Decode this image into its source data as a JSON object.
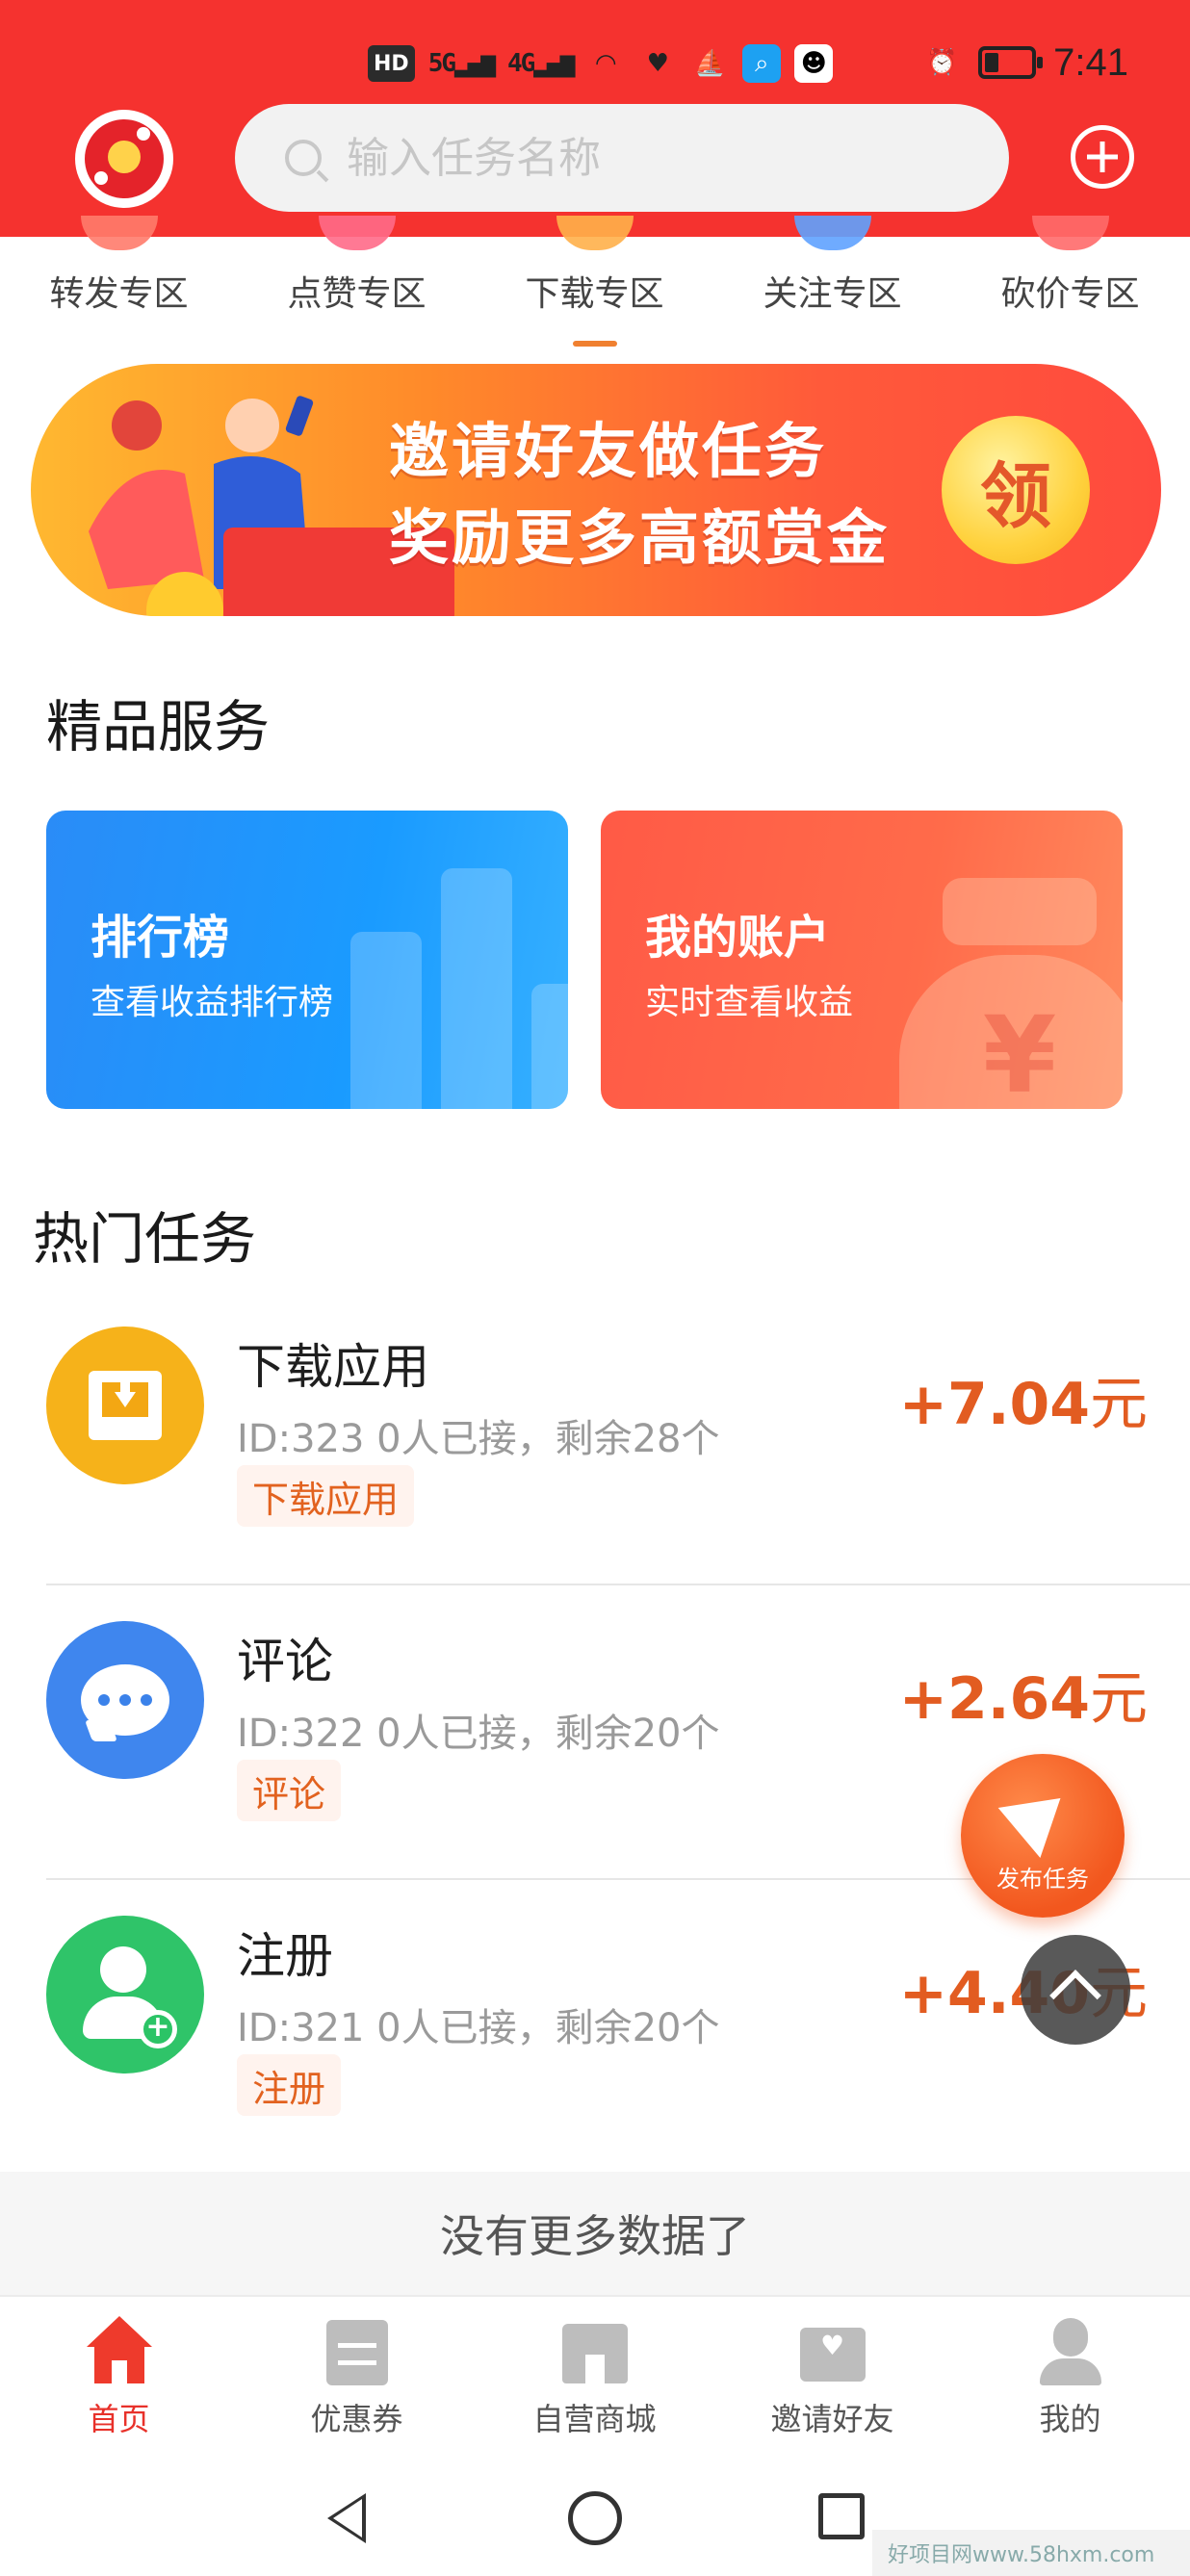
{
  "status_bar": {
    "indicators": [
      "HD",
      "5G",
      "4G"
    ],
    "time": "7:41",
    "battery_level": 0.3
  },
  "header": {
    "logo_icon": "app-logo",
    "search_placeholder": "输入任务名称",
    "add_icon": "plus-circle-icon",
    "colors": {
      "header_bg": "#f5322f"
    }
  },
  "tabs": [
    {
      "label": "转发专区",
      "active": false
    },
    {
      "label": "点赞专区",
      "active": false
    },
    {
      "label": "下载专区",
      "active": true
    },
    {
      "label": "关注专区",
      "active": false
    },
    {
      "label": "砍价专区",
      "active": false
    }
  ],
  "banner": {
    "line1": "邀请好友做任务",
    "line2": "奖励更多高额赏金",
    "button": "领"
  },
  "services": {
    "title": "精品服务",
    "cards": [
      {
        "title": "排行榜",
        "subtitle": "查看收益排行榜"
      },
      {
        "title": "我的账户",
        "subtitle": "实时查看收益"
      }
    ]
  },
  "hot_tasks": {
    "title": "热门任务",
    "items": [
      {
        "name": "下载应用",
        "meta": "ID:323   0人已接，剩余28个",
        "tag": "下载应用",
        "reward": "+7.04",
        "unit": "元",
        "icon": "download-icon",
        "color": "#f6b21a"
      },
      {
        "name": "评论",
        "meta": "ID:322   0人已接，剩余20个",
        "tag": "评论",
        "reward": "+2.64",
        "unit": "元",
        "icon": "comment-bubble-icon",
        "color": "#3f86ee"
      },
      {
        "name": "注册",
        "meta": "ID:321   0人已接，剩余20个",
        "tag": "注册",
        "reward": "+4.40",
        "unit": "元",
        "icon": "add-user-icon",
        "color": "#2fc469"
      }
    ]
  },
  "no_more": "没有更多数据了",
  "fab": {
    "publish_label": "发布任务"
  },
  "bottom_nav": [
    {
      "label": "首页",
      "active": true
    },
    {
      "label": "优惠券",
      "active": false
    },
    {
      "label": "自营商城",
      "active": false
    },
    {
      "label": "邀请好友",
      "active": false
    },
    {
      "label": "我的",
      "active": false
    }
  ],
  "watermark": "好项目网www.58hxm.com"
}
